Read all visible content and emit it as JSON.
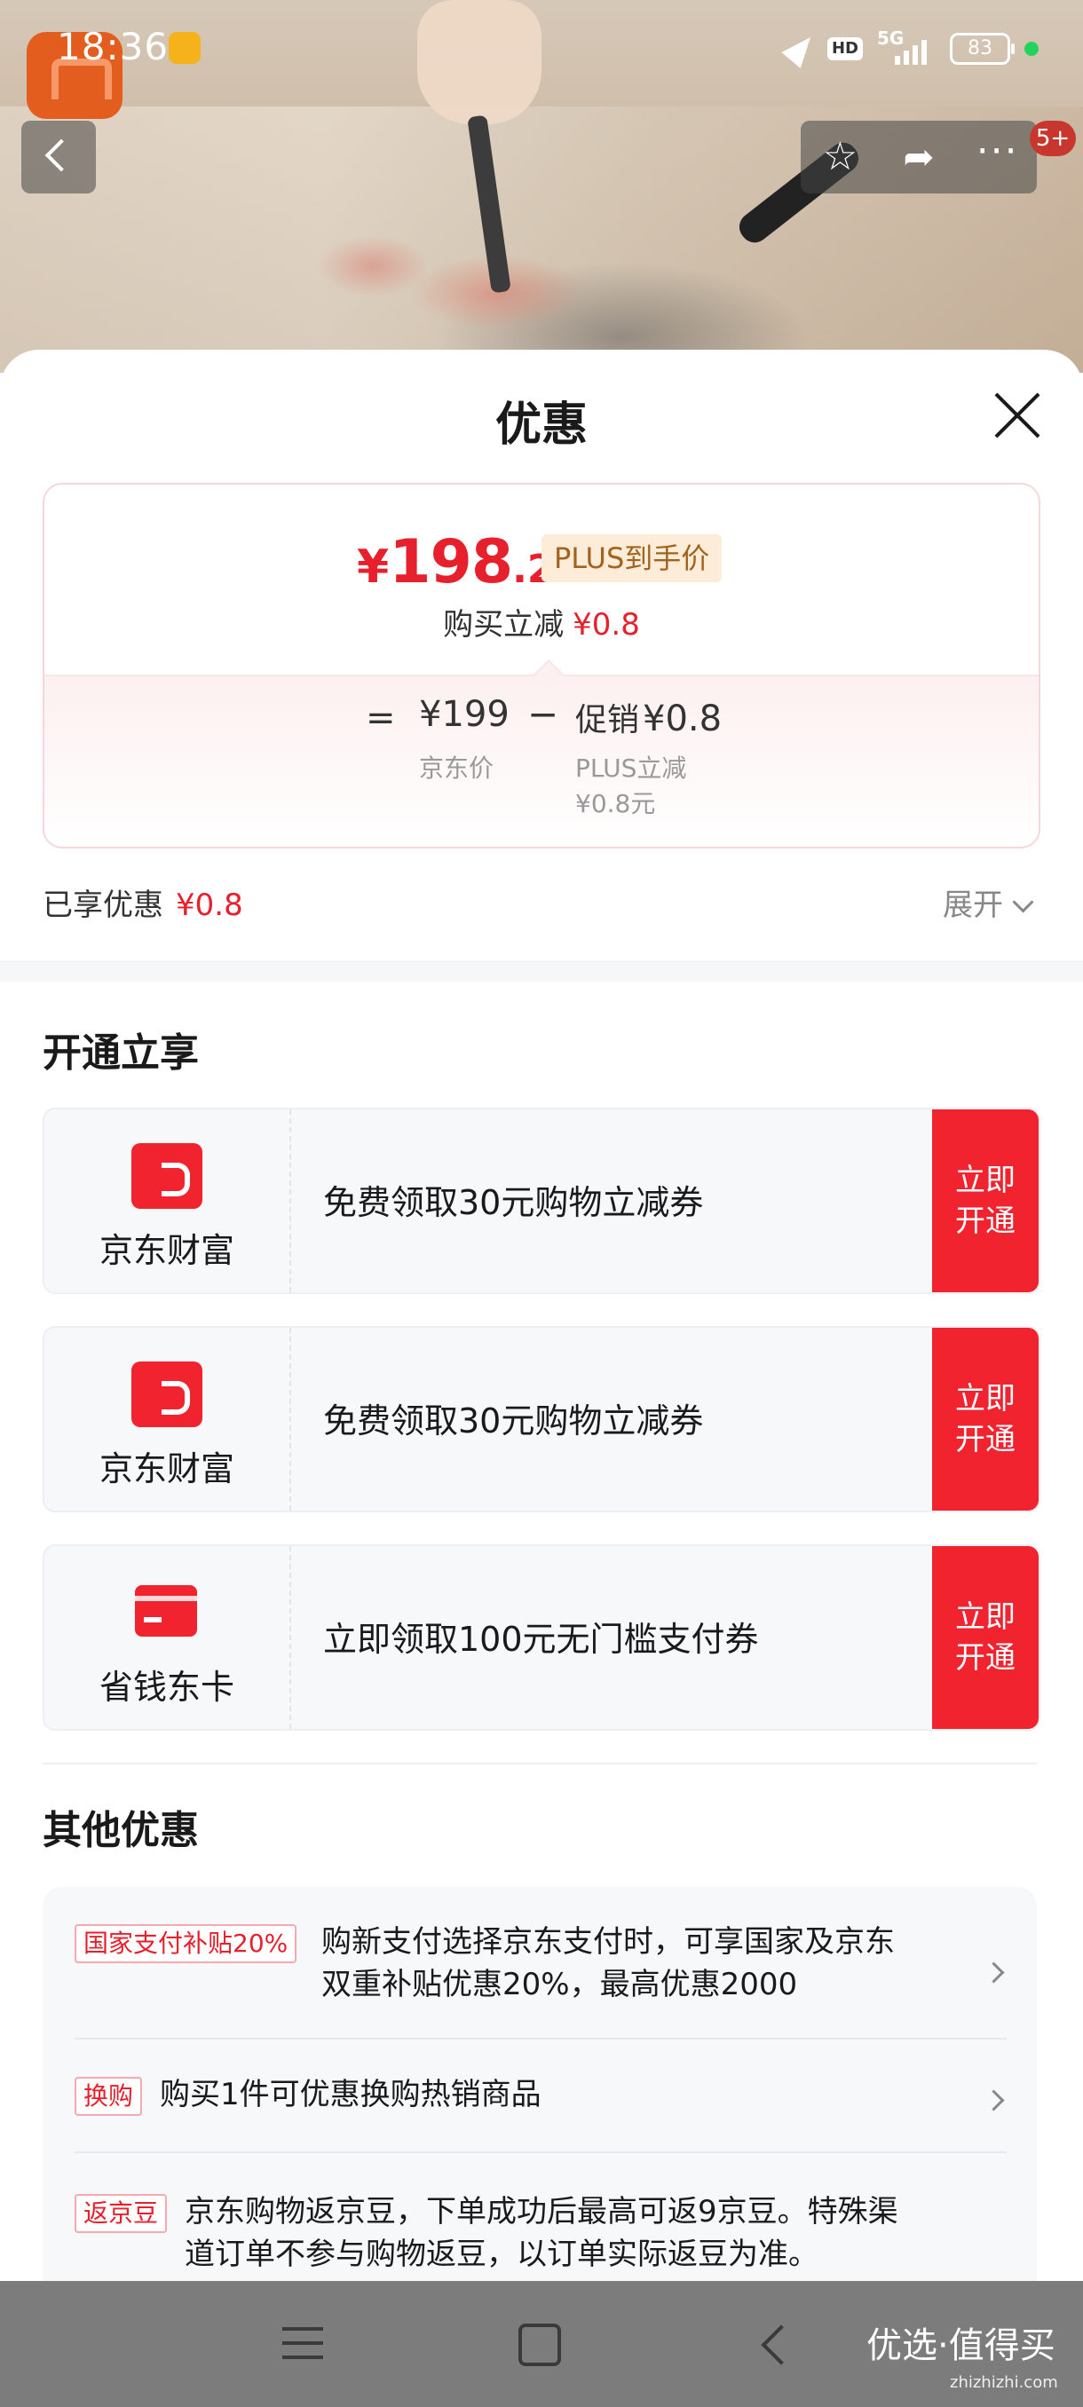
{
  "status_bar": {
    "time": "18:36",
    "network": "5G",
    "hd": "HD",
    "battery": "83"
  },
  "top_nav": {
    "badge": "5+"
  },
  "sheet": {
    "title": "优惠",
    "price": {
      "symbol": "¥",
      "integer": "198",
      "decimal": ".2",
      "tag": "PLUS到手价"
    },
    "instant_reduce": {
      "label": "购买立减",
      "amount": "¥0.8"
    },
    "calc": {
      "equals": "=",
      "jd_price": "¥199",
      "jd_price_label": "京东价",
      "minus": "−",
      "promo_label": "促销",
      "promo_amount": "¥0.8",
      "plus_label": "PLUS立减",
      "plus_amount": "¥0.8元"
    },
    "enjoyed": {
      "label": "已享优惠",
      "amount": "¥0.8"
    },
    "expand_label": "展开"
  },
  "activate_section": {
    "title": "开通立享",
    "offers": [
      {
        "brand": "京东财富",
        "text": "免费领取30元购物立减券",
        "button": "立即开通",
        "icon": "jd-finance-icon"
      },
      {
        "brand": "京东财富",
        "text": "免费领取30元购物立减券",
        "button": "立即开通",
        "icon": "jd-finance-icon"
      },
      {
        "brand": "省钱东卡",
        "text": "立即领取100元无门槛支付券",
        "button": "立即开通",
        "icon": "card-icon"
      }
    ]
  },
  "other_section": {
    "title": "其他优惠",
    "items": [
      {
        "tag": "国家支付补贴20%",
        "line1": "购新支付选择京东支付时，可享国家及京东",
        "line2": "双重补贴优惠20%，最高优惠2000"
      },
      {
        "tag": "换购",
        "line1": "购买1件可优惠换购热销商品"
      },
      {
        "tag": "返京豆",
        "line1": "京东购物返京豆，下单成功后最高可返9京豆。特殊渠",
        "line2": "道订单不参与购物返豆，以订单实际返豆为准。"
      }
    ]
  },
  "watermark": {
    "text": "优选·值得买",
    "sub": "zhizhizhi.com"
  },
  "colors": {
    "accent": "#f0232f",
    "price_red": "#e6202c",
    "plus_gold": "#a2631f"
  }
}
